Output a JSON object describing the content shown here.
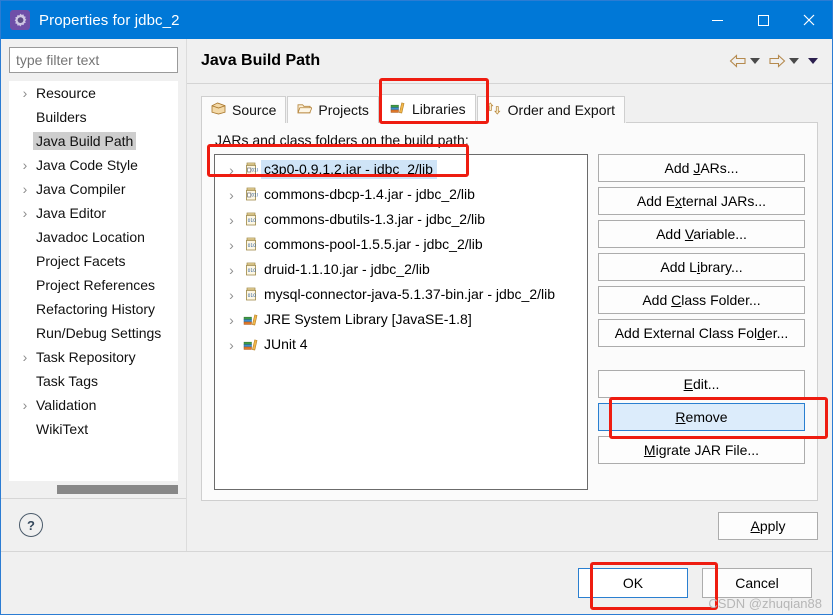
{
  "window": {
    "title": "Properties for jdbc_2",
    "icon": "properties-gear-icon",
    "minimize_label": "Minimize",
    "maximize_label": "Maximize",
    "close_label": "Close"
  },
  "sidebar": {
    "filter": {
      "placeholder": "type filter text",
      "value": ""
    },
    "items": [
      {
        "label": "Resource",
        "expandable": true,
        "selected": false
      },
      {
        "label": "Builders",
        "expandable": false,
        "selected": false
      },
      {
        "label": "Java Build Path",
        "expandable": false,
        "selected": true
      },
      {
        "label": "Java Code Style",
        "expandable": true,
        "selected": false
      },
      {
        "label": "Java Compiler",
        "expandable": true,
        "selected": false
      },
      {
        "label": "Java Editor",
        "expandable": true,
        "selected": false
      },
      {
        "label": "Javadoc Location",
        "expandable": false,
        "selected": false
      },
      {
        "label": "Project Facets",
        "expandable": false,
        "selected": false
      },
      {
        "label": "Project References",
        "expandable": false,
        "selected": false
      },
      {
        "label": "Refactoring History",
        "expandable": false,
        "selected": false
      },
      {
        "label": "Run/Debug Settings",
        "expandable": false,
        "selected": false
      },
      {
        "label": "Task Repository",
        "expandable": true,
        "selected": false
      },
      {
        "label": "Task Tags",
        "expandable": false,
        "selected": false
      },
      {
        "label": "Validation",
        "expandable": true,
        "selected": false
      },
      {
        "label": "WikiText",
        "expandable": false,
        "selected": false
      }
    ],
    "help_button": "?"
  },
  "page": {
    "title": "Java Build Path",
    "nav": {
      "back": "back-arrow-icon",
      "back_menu": "back-history-dropdown",
      "forward": "forward-arrow-icon",
      "forward_menu": "forward-history-dropdown",
      "view_menu": "view-menu-dropdown"
    },
    "tabs": [
      {
        "label": "Source",
        "icon": "source-package-icon",
        "active": false
      },
      {
        "label": "Projects",
        "icon": "open-folder-icon",
        "active": false
      },
      {
        "label": "Libraries",
        "icon": "books-icon",
        "active": true
      },
      {
        "label": "Order and Export",
        "icon": "order-arrows-icon",
        "active": false
      }
    ],
    "list_label": "JARs and class folders on the build path:",
    "entries": [
      {
        "label": "c3p0-0.9.1.2.jar - jdbc_2/lib",
        "icon": "jar-with-source-icon",
        "selected": true
      },
      {
        "label": "commons-dbcp-1.4.jar - jdbc_2/lib",
        "icon": "jar-with-source-icon",
        "selected": false
      },
      {
        "label": "commons-dbutils-1.3.jar - jdbc_2/lib",
        "icon": "jar-icon",
        "selected": false
      },
      {
        "label": "commons-pool-1.5.5.jar - jdbc_2/lib",
        "icon": "jar-icon",
        "selected": false
      },
      {
        "label": "druid-1.1.10.jar - jdbc_2/lib",
        "icon": "jar-icon",
        "selected": false
      },
      {
        "label": "mysql-connector-java-5.1.37-bin.jar - jdbc_2/lib",
        "icon": "jar-icon",
        "selected": false
      },
      {
        "label": "JRE System Library [JavaSE-1.8]",
        "icon": "library-books-icon",
        "selected": false
      },
      {
        "label": "JUnit 4",
        "icon": "library-books-icon",
        "selected": false
      }
    ],
    "buttons": [
      {
        "label": "Add JARs...",
        "mnemonic": "J",
        "state": "normal"
      },
      {
        "label": "Add External JARs...",
        "mnemonic": "x",
        "state": "normal"
      },
      {
        "label": "Add Variable...",
        "mnemonic": "V",
        "state": "normal"
      },
      {
        "label": "Add Library...",
        "mnemonic": "i",
        "state": "normal"
      },
      {
        "label": "Add Class Folder...",
        "mnemonic": "C",
        "state": "normal"
      },
      {
        "label": "Add External Class Folder...",
        "mnemonic": "d",
        "state": "normal"
      },
      {
        "label": "Edit...",
        "mnemonic": "E",
        "state": "normal"
      },
      {
        "label": "Remove",
        "mnemonic": "R",
        "state": "focused"
      },
      {
        "label": "Migrate JAR File...",
        "mnemonic": "M",
        "state": "normal"
      }
    ],
    "apply_label": "Apply"
  },
  "footer": {
    "ok_label": "OK",
    "cancel_label": "Cancel"
  },
  "watermark": "CSDN @zhuqian88",
  "colors": {
    "titlebar": "#0078d7",
    "accent": "#2a7fd0",
    "annotation": "#ee1c10",
    "selection": "#cfe4f7",
    "tree_selection": "#cecece"
  }
}
